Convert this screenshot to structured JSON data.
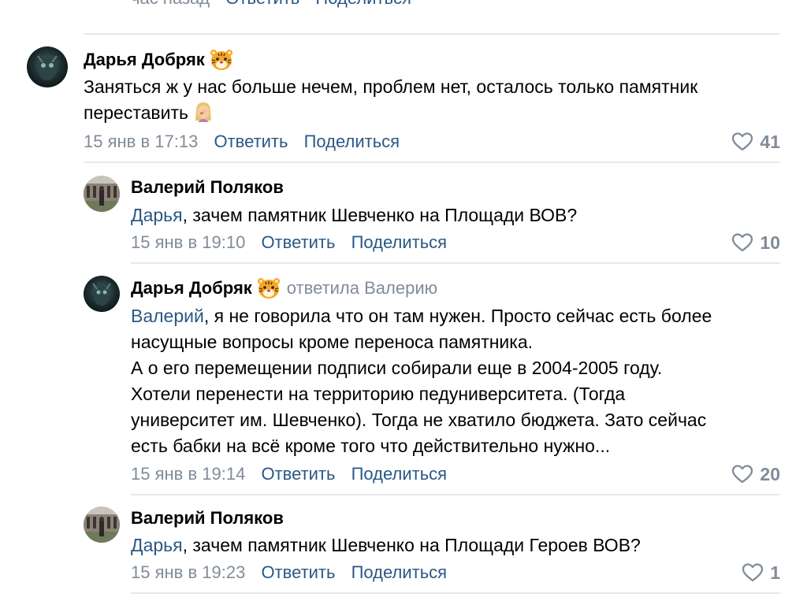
{
  "top": {
    "time": "час назад",
    "reply": "Ответить",
    "share": "Поделиться"
  },
  "comments": [
    {
      "author": "Дарья Добряк",
      "lines": [
        "Заняться ж у нас больше нечем, проблем нет, осталось только памятник",
        "переставить"
      ],
      "time": "15 янв в 17:13",
      "reply": "Ответить",
      "share": "Поделиться",
      "likes": "41"
    },
    {
      "author": "Валерий Поляков",
      "mention": "Дарья",
      "text": ", зачем памятник Шевченко на Площади ВОВ?",
      "time": "15 янв в 19:10",
      "reply": "Ответить",
      "share": "Поделиться",
      "likes": "10"
    },
    {
      "author": "Дарья Добряк",
      "replied_to": "ответила Валерию",
      "mention": "Валерий",
      "first_line": ", я не говорила что он там нужен. Просто сейчас есть более",
      "lines": [
        "насущные вопросы кроме переноса памятника.",
        "А о его перемещении подписи собирали еще в 2004-2005 году.",
        "Хотели перенести на территорию педуниверситета. (Тогда",
        "университет им. Шевченко). Тогда не хватило бюджета. Зато сейчас",
        "есть бабки на всё кроме того что действительно нужно..."
      ],
      "time": "15 янв в 19:14",
      "reply": "Ответить",
      "share": "Поделиться",
      "likes": "20"
    },
    {
      "author": "Валерий Поляков",
      "mention": "Дарья",
      "text": ", зачем памятник Шевченко на Площади Героев ВОВ?",
      "time": "15 янв в 19:23",
      "reply": "Ответить",
      "share": "Поделиться",
      "likes": "1"
    }
  ],
  "icons": {
    "like": "heart-outline-icon",
    "tiger": "tiger-face-emoji",
    "facepalm": "woman-facepalming-emoji"
  },
  "colors": {
    "link": "#2a5885",
    "muted": "#818c99",
    "divider": "#e7e8ec"
  }
}
